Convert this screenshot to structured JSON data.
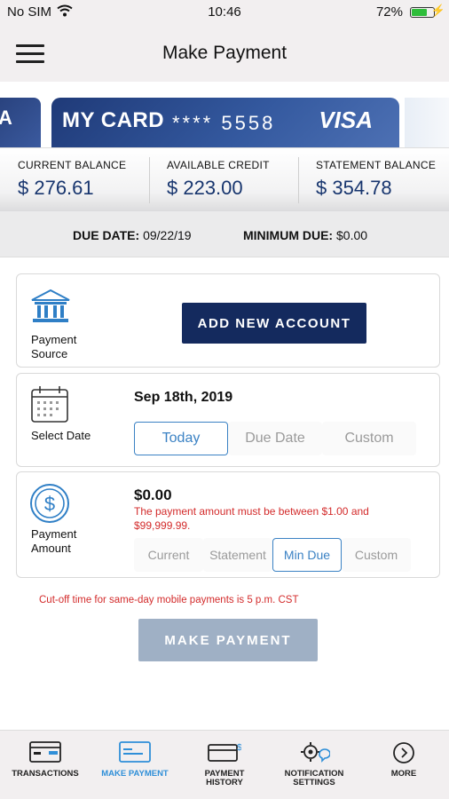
{
  "status_bar": {
    "carrier": "No SIM",
    "time": "10:46",
    "battery": "72%"
  },
  "nav": {
    "title": "Make Payment"
  },
  "cards": {
    "prev_card_fragment": "A",
    "current": {
      "name": "MY CARD",
      "number": "**** 5558",
      "brand": "VISA"
    }
  },
  "balances": [
    {
      "label": "CURRENT BALANCE",
      "value": "$ 276.61"
    },
    {
      "label": "AVAILABLE CREDIT",
      "value": "$ 223.00"
    },
    {
      "label": "STATEMENT BALANCE",
      "value": "$ 354.78"
    }
  ],
  "due": {
    "due_date_label": "DUE DATE:",
    "due_date_value": "09/22/19",
    "min_due_label": "MINIMUM DUE:",
    "min_due_value": "$0.00"
  },
  "payment_source": {
    "label_line1": "Payment",
    "label_line2": "Source",
    "button": "ADD NEW ACCOUNT"
  },
  "select_date": {
    "label": "Select Date",
    "date": "Sep 18th, 2019",
    "options": [
      "Today",
      "Due Date",
      "Custom"
    ],
    "selected": "Today"
  },
  "payment_amount": {
    "label_line1": "Payment",
    "label_line2": "Amount",
    "amount": "$0.00",
    "error": "The payment amount must be between $1.00 and $99,999.99.",
    "options": [
      "Current",
      "Statement",
      "Min Due",
      "Custom"
    ],
    "selected": "Min Due"
  },
  "cutoff_note": "Cut-off time for same-day mobile payments is 5 p.m. CST",
  "make_payment_button": "MAKE PAYMENT",
  "tabs": [
    {
      "label": "TRANSACTIONS",
      "icon": "transactions-icon"
    },
    {
      "label": "MAKE PAYMENT",
      "icon": "make-payment-icon",
      "active": true
    },
    {
      "label_line1": "PAYMENT",
      "label_line2": "HISTORY",
      "icon": "payment-history-icon"
    },
    {
      "label_line1": "NOTIFICATION",
      "label_line2": "SETTINGS",
      "icon": "notification-settings-icon"
    },
    {
      "label": "MORE",
      "icon": "more-icon"
    }
  ],
  "colors": {
    "primary": "#142a5e",
    "accent": "#3b82c4",
    "error": "#d32b2b",
    "disabled_button": "#9fb0c5",
    "active_tab": "#2f8fd8"
  }
}
